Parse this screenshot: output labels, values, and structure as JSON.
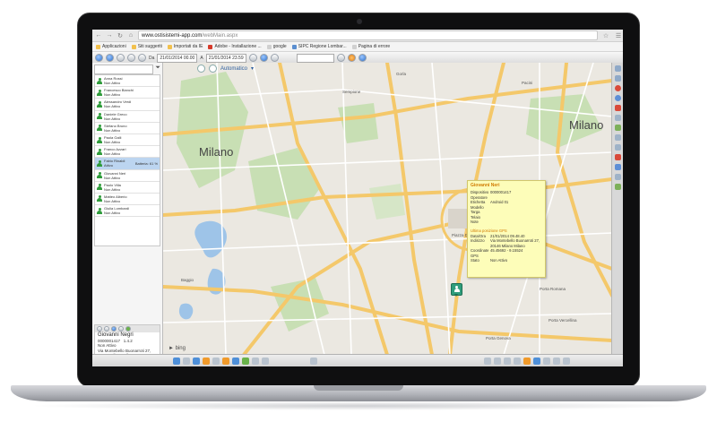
{
  "browser": {
    "url_host": "www.ostisistemi-app.com",
    "url_path": "/webMain.aspx",
    "bookmarks": [
      "Applicazioni",
      "Siti suggeriti",
      "Importati da IE",
      "Adobe - Installazione ...",
      "google",
      "SIPC Regione Lombar...",
      "Pagina di errore"
    ]
  },
  "toolbar": {
    "da_label": "Da",
    "from_datetime": "21/01/2014 00.00",
    "a_label": "A",
    "to_datetime": "21/01/2014 23.59"
  },
  "map": {
    "mode": "Automatico",
    "provider": "bing"
  },
  "vehicles": [
    {
      "name": "Anna Rossi",
      "status": "Non Attivo",
      "extra": ""
    },
    {
      "name": "Francesco Bianchi",
      "status": "Non Attivo",
      "extra": ""
    },
    {
      "name": "Alessandro Verdi",
      "status": "Non Attivo",
      "extra": ""
    },
    {
      "name": "Daniele Greco",
      "status": "Non Attivo",
      "extra": ""
    },
    {
      "name": "Stefano Bruno",
      "status": "Non Attivo",
      "extra": ""
    },
    {
      "name": "Paola Galli",
      "status": "Non Attivo",
      "extra": ""
    },
    {
      "name": "Franco Azzari",
      "status": "Non Attivo",
      "extra": ""
    },
    {
      "name": "Fabio Rinaldi",
      "status": "Attivo",
      "extra": "Batteria: 61 %"
    },
    {
      "name": "Giovanni Neri",
      "status": "Non Attivo",
      "extra": ""
    },
    {
      "name": "Paolo Villa",
      "status": "Non Attivo",
      "extra": ""
    },
    {
      "name": "Matteo Alberio",
      "status": "Non Attivo",
      "extra": ""
    },
    {
      "name": "Giulia Lombardi",
      "status": "Non Attivo",
      "extra": ""
    }
  ],
  "detail": {
    "name": "Giovanni Negri",
    "device": "0000001417",
    "version": "1.4.2",
    "status": "Non Attivo",
    "address_line1": "Via Montebello Buonarroti 27,",
    "address_line2": "20146 Milano Milano"
  },
  "popup": {
    "name": "Giovanni Neri",
    "rows": [
      {
        "key": "Dispositivo",
        "value": "0000001417"
      },
      {
        "key": "Operatore",
        "value": ""
      },
      {
        "key": "Etichetta",
        "value": "Android 01"
      },
      {
        "key": "Modello",
        "value": ""
      },
      {
        "key": "Targa",
        "value": ""
      },
      {
        "key": "Telaio",
        "value": ""
      },
      {
        "key": "Note",
        "value": ""
      }
    ],
    "gps_title": "Ultima posizione GPS",
    "gps_rows": [
      {
        "key": "Data/Ora",
        "value": "21/01/2014 09.48.40"
      },
      {
        "key": "Indirizzo",
        "value": "Via Montebello Buonarroti 27, 20146 Milano Milano"
      },
      {
        "key": "Coordinate GPS",
        "value": "45.45692 - 9.15524"
      },
      {
        "key": "Stato",
        "value": "Non Attivo"
      }
    ]
  },
  "map_labels": [
    "Milano",
    "Milano",
    "Piazza Duomo",
    "Porta Romana",
    "Porta Vercellina",
    "Porta Genova",
    "Sempione",
    "Pacini",
    "Gorla",
    "Baggio"
  ]
}
